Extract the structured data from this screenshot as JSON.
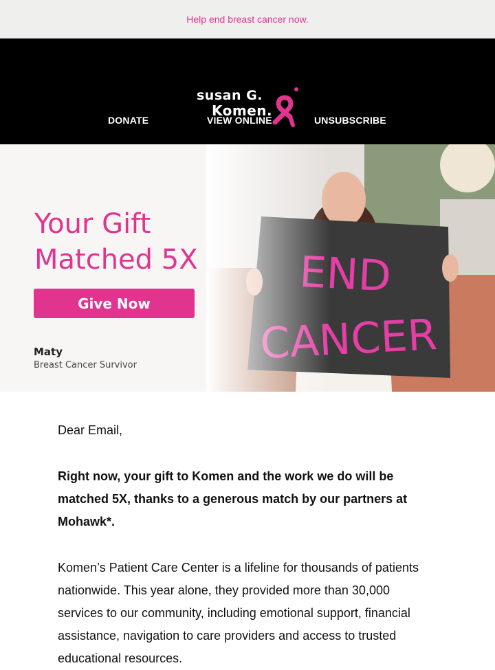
{
  "preheader": {
    "text": "Help end breast cancer now."
  },
  "header": {
    "logo": {
      "line1": "susan G.",
      "line2": "Komen."
    },
    "nav": [
      {
        "label": "DONATE"
      },
      {
        "label": "VIEW ONLINE"
      },
      {
        "label": "UNSUBSCRIBE"
      }
    ]
  },
  "hero": {
    "title_line1": "Your Gift",
    "title_line2": "Matched 5X",
    "button_label": "Give Now",
    "person_name": "Maty",
    "person_role": "Breast Cancer Survivor",
    "sign_line1": "END",
    "sign_line2": "CANCER"
  },
  "body": {
    "salutation": "Dear Email,",
    "lead": "Right now, your gift to Komen and the work we do will be matched 5X, thanks to a generous match by our partners at Mohawk*.",
    "paragraph": "Komen’s Patient Care Center is a lifeline for thousands of patients nationwide. This year alone, they provided more than 30,000 services to our community, including emotional support, financial assistance, navigation to care providers and access to trusted educational resources."
  },
  "colors": {
    "brand_pink": "#e0348e",
    "header_bg": "#000000",
    "preheader_bg": "#efefee"
  },
  "icons": {
    "logo_ribbon": "pink-ribbon-icon"
  }
}
